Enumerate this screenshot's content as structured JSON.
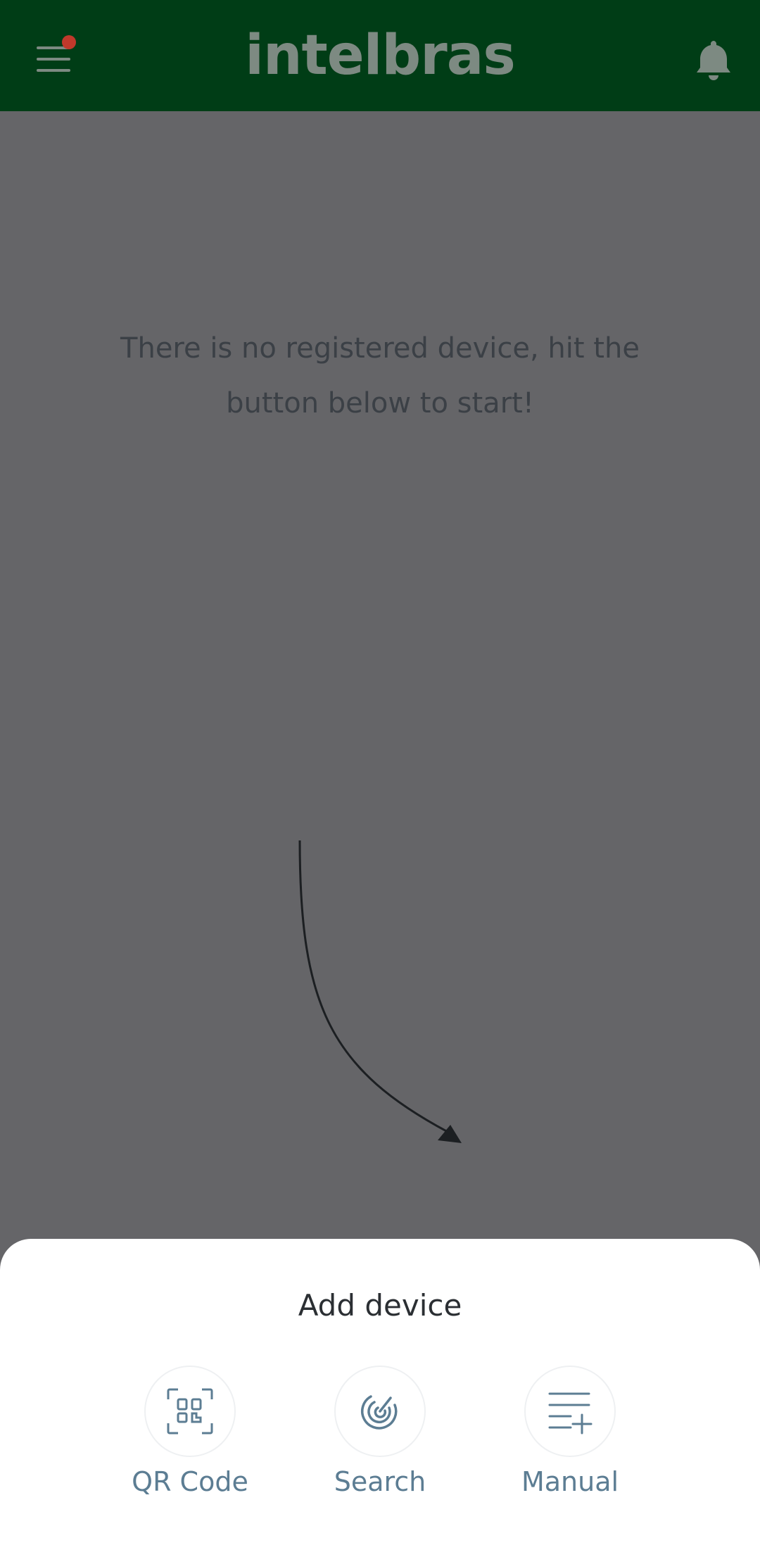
{
  "header": {
    "logo_text": "intelbras",
    "menu_icon": "hamburger-menu-icon",
    "notification_icon": "bell-icon",
    "colors": {
      "header_bg": "#003d16",
      "logo": "#7d8a82",
      "badge": "#c0392b"
    }
  },
  "main": {
    "empty_message": "There is no registered device, hit the button below to start!"
  },
  "sheet": {
    "title": "Add device",
    "options": [
      {
        "label": "QR Code",
        "icon": "qr-code-icon"
      },
      {
        "label": "Search",
        "icon": "search-radar-icon"
      },
      {
        "label": "Manual",
        "icon": "list-add-icon"
      }
    ],
    "colors": {
      "option_label": "#5c7d93",
      "option_icon": "#5c7d93"
    }
  }
}
